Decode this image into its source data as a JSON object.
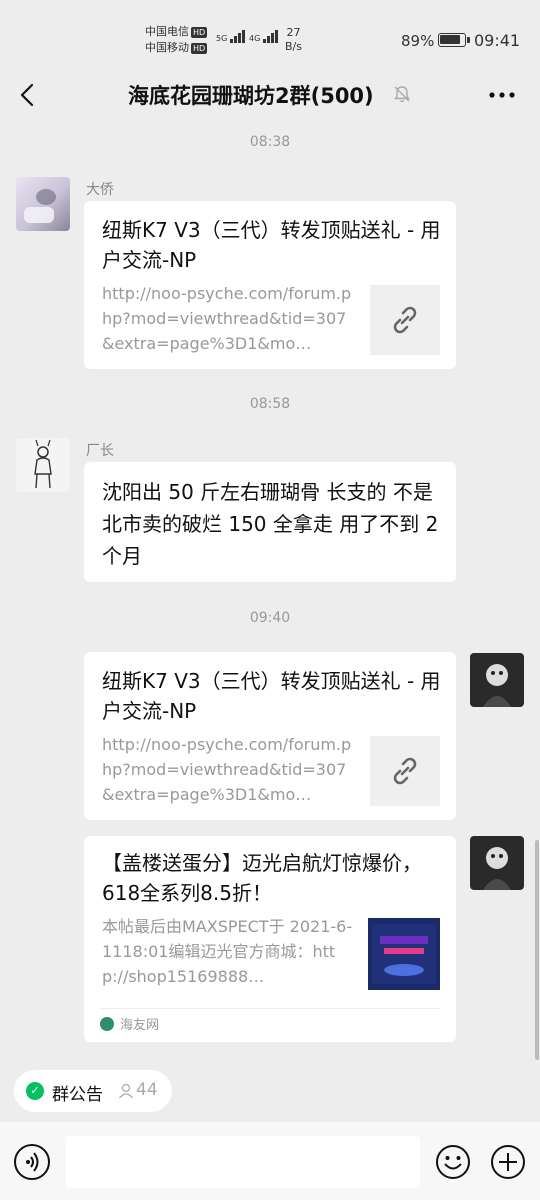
{
  "status_bar": {
    "carrier1": "中国电信",
    "carrier2": "中国移动",
    "hd": "HD",
    "net1": "5G",
    "net2": "4G",
    "speed_value": "27",
    "speed_unit": "B/s",
    "battery": "89%",
    "battery_level": 0.89,
    "time": "09:41"
  },
  "header": {
    "title": "海底花园珊瑚坊2群(500)",
    "back_icon": "chevron-left-icon",
    "mute_icon": "bell-off-icon",
    "more_icon": "more-dots-icon"
  },
  "messages": [
    {
      "time": "08:38"
    },
    {
      "sender": "大侨",
      "type": "link",
      "title": "纽斯K7 V3（三代）转发顶贴送礼 - 用户交流-NP",
      "desc": "http://noo-psyche.com/forum.php?mod=viewthread&tid=307&extra=page%3D1&mo…",
      "thumb_icon": "link-icon"
    },
    {
      "time": "08:58"
    },
    {
      "sender": "厂长",
      "type": "text",
      "text": "沈阳出 50 斤左右珊瑚骨 长支的 不是北市卖的破烂  150 全拿走 用了不到 2 个月"
    },
    {
      "time": "09:40"
    },
    {
      "type": "link",
      "mine": true,
      "title": "纽斯K7 V3（三代）转发顶贴送礼 - 用户交流-NP",
      "desc": "http://noo-psyche.com/forum.php?mod=viewthread&tid=307&extra=page%3D1&mo…",
      "thumb_icon": "link-icon"
    },
    {
      "type": "article",
      "mine": true,
      "title": "【盖楼送蛋分】迈光启航灯惊爆价，618全系列8.5折！",
      "desc": "本帖最后由MAXSPECT于 2021-6-1118:01编辑迈光官方商城：http://shop15169888…",
      "source": "海友网"
    }
  ],
  "bottom": {
    "notice_label": "群公告",
    "member_count": "44",
    "input_value": "",
    "voice_icon": "voice-icon",
    "emoji_icon": "emoji-icon",
    "plus_icon": "plus-circle-icon"
  },
  "colors": {
    "background": "#ededed",
    "bubble": "#ffffff",
    "accent_green": "#07c160"
  }
}
